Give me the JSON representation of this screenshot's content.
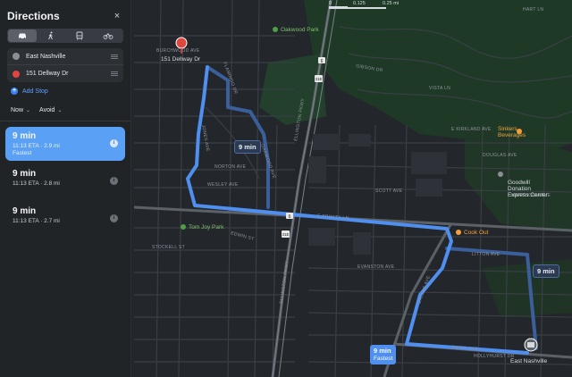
{
  "panel": {
    "title": "Directions",
    "close_icon": "×",
    "modes": [
      {
        "name": "car-icon",
        "active": true
      },
      {
        "name": "walk-icon",
        "active": false
      },
      {
        "name": "transit-icon",
        "active": false
      },
      {
        "name": "bike-icon",
        "active": false
      }
    ],
    "stops": [
      {
        "label": "East Nashville",
        "icon": "gray"
      },
      {
        "label": "151 Dellway Dr",
        "icon": "red"
      }
    ],
    "add_stop": "Add Stop",
    "options": {
      "depart": "Now",
      "avoid": "Avoid"
    },
    "routes": [
      {
        "time": "9 min",
        "eta": "11:13 ETA · 2.9 mi",
        "tag": "Fastest",
        "selected": true
      },
      {
        "time": "9 min",
        "eta": "11:13 ETA · 2.8 mi",
        "tag": "",
        "selected": false
      },
      {
        "time": "9 min",
        "eta": "11:13 ETA · 2.7 mi",
        "tag": "",
        "selected": false
      }
    ]
  },
  "scale": {
    "labels": [
      "0",
      "0.125",
      "0.25 mi"
    ]
  },
  "map": {
    "pois": {
      "destination_pin": "151 Dellway Dr",
      "origin_pin": "East Nashville",
      "oakwood_park": "Oakwood Park",
      "tom_joy_park": "Tom Joy Park",
      "sinkers": "Sinkers\nBeverages",
      "goodwill": "Goodwill\nDonation\nExpress Center",
      "cook_out": "Cook Out"
    },
    "road_labels": {
      "trinity": "E TRINITY LN",
      "ellington": "ELLINGTON PKWY",
      "dallas": "DALLAS AVE",
      "litton": "LITTON AVE",
      "cahal": "CAHAL AVE",
      "jones": "JONES AVE",
      "oakwood": "OAKWOOD AVE",
      "norton": "NORTON AVE",
      "wesley": "WESLEY AVE",
      "kirkland": "E KIRKLAND AVE",
      "ellington2": "ELLINGTON PKWY",
      "flamingo": "FLAMINGO DR",
      "gibson": "GIBSON DR",
      "douglas": "DOUGLAS AVE",
      "hart": "HART LN",
      "vista": "VISTA LN",
      "marthonia": "MARTHONIA AVE",
      "stockell": "STOCKELL ST",
      "edwin": "EDWIN ST",
      "evanston": "EVANSTON AVE",
      "scott": "SCOTT AVE",
      "hollyhurst": "HOLLYHURST DR",
      "burchwood": "BURCHWOOD AVE"
    },
    "route_shields": [
      "6",
      "31E",
      "6",
      "31E"
    ],
    "callouts": {
      "primary_time": "9 min",
      "primary_tag": "Fastest",
      "alt1": "9 min",
      "alt2": "9 min"
    }
  },
  "colors": {
    "route_selected": "#4f8fef",
    "route_alt": "#3a5f9a",
    "accent": "#5aa0f5"
  }
}
